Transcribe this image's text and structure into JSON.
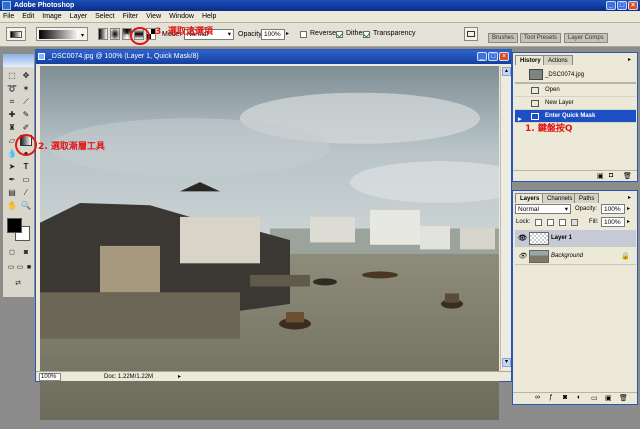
{
  "app": {
    "title": "Adobe Photoshop",
    "window_controls": [
      "_",
      "□",
      "×"
    ]
  },
  "menu": [
    "File",
    "Edit",
    "Image",
    "Layer",
    "Select",
    "Filter",
    "View",
    "Window",
    "Help"
  ],
  "options_bar": {
    "mode_label": "Mode:",
    "mode_value": "Normal",
    "opacity_label": "Opacity:",
    "opacity_value": "100%",
    "reverse_label": "Reverse",
    "reverse_checked": false,
    "dither_label": "Dither",
    "dither_checked": true,
    "transparency_label": "Transparency",
    "transparency_checked": true,
    "well_tabs": [
      "Brushes",
      "Tool Presets",
      "Layer Comps"
    ]
  },
  "document": {
    "title": "_DSC0074.jpg @ 100% (Layer 1, Quick Mask/8)",
    "zoom": "100%",
    "doc_info": "Doc: 1.22M/1.22M"
  },
  "history_palette": {
    "tabs": [
      "History",
      "Actions"
    ],
    "snapshot": "_DSC0074.jpg",
    "states": [
      "Open",
      "New Layer",
      "Enter Quick Mask"
    ],
    "selected_state": "Enter Quick Mask"
  },
  "layers_palette": {
    "tabs": [
      "Layers",
      "Channels",
      "Paths"
    ],
    "blend_mode": "Normal",
    "opacity_label": "Opacity:",
    "opacity_value": "100%",
    "lock_label": "Lock:",
    "fill_label": "Fill:",
    "fill_value": "100%",
    "layers": [
      {
        "name": "Layer 1",
        "selected": true
      },
      {
        "name": "Background",
        "selected": false,
        "locked": true
      }
    ]
  },
  "annotations": {
    "step1": "1. 鍵盤按Q",
    "step2": "2. 選取漸層工具",
    "step3": "3. 選取這選項"
  },
  "colors": {
    "title_blue": "#0a2c8a",
    "selection_blue": "#1c4fc4",
    "annotation_red": "#e21414",
    "foreground": "#000000",
    "background": "#ffffff"
  }
}
